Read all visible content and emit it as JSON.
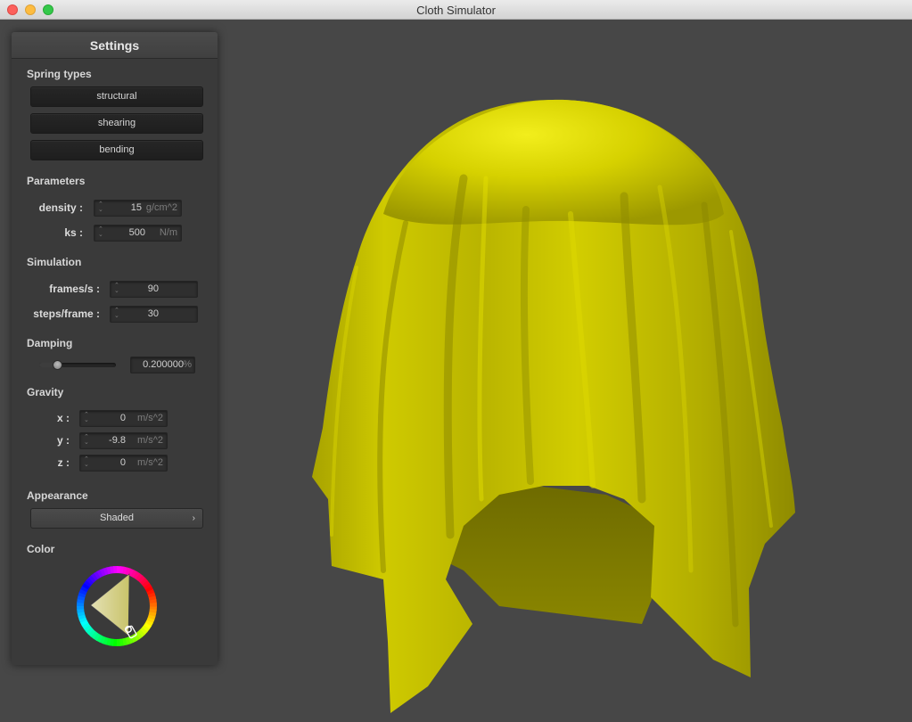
{
  "window": {
    "title": "Cloth Simulator"
  },
  "settings": {
    "title": "Settings",
    "spring_types": {
      "label": "Spring types",
      "buttons": [
        "structural",
        "shearing",
        "bending"
      ]
    },
    "parameters": {
      "label": "Parameters",
      "density": {
        "label": "density :",
        "value": "15",
        "unit": "g/cm^2"
      },
      "ks": {
        "label": "ks :",
        "value": "500",
        "unit": "N/m"
      }
    },
    "simulation": {
      "label": "Simulation",
      "frames": {
        "label": "frames/s :",
        "value": "90"
      },
      "steps": {
        "label": "steps/frame :",
        "value": "30"
      }
    },
    "damping": {
      "label": "Damping",
      "slider_fraction": 0.2,
      "value": "0.200000",
      "unit": "%"
    },
    "gravity": {
      "label": "Gravity",
      "x": {
        "label": "x :",
        "value": "0",
        "unit": "m/s^2"
      },
      "y": {
        "label": "y :",
        "value": "-9.8",
        "unit": "m/s^2"
      },
      "z": {
        "label": "z :",
        "value": "0",
        "unit": "m/s^2"
      }
    },
    "appearance": {
      "label": "Appearance",
      "selected": "Shaded"
    },
    "color": {
      "label": "Color",
      "value": "#ffff00"
    }
  },
  "scene": {
    "cloth_color": "#c8c300",
    "background": "#474747"
  }
}
